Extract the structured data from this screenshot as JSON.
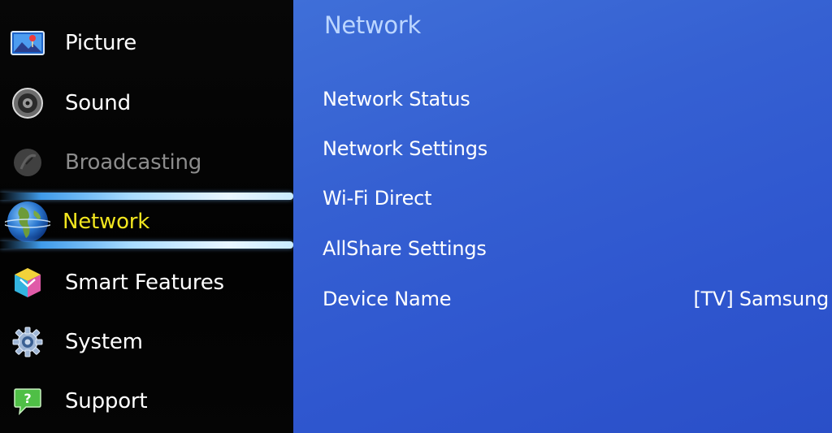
{
  "sidebar": {
    "items": [
      {
        "label": "Picture",
        "icon": "picture-icon",
        "state": "normal"
      },
      {
        "label": "Sound",
        "icon": "speaker-icon",
        "state": "normal"
      },
      {
        "label": "Broadcasting",
        "icon": "satellite-dish-icon",
        "state": "disabled"
      },
      {
        "label": "Network",
        "icon": "globe-icon",
        "state": "selected"
      },
      {
        "label": "Smart Features",
        "icon": "smart-cube-icon",
        "state": "normal"
      },
      {
        "label": "System",
        "icon": "gear-icon",
        "state": "normal"
      },
      {
        "label": "Support",
        "icon": "help-bubble-icon",
        "state": "normal"
      }
    ]
  },
  "main": {
    "title": "Network",
    "items": [
      {
        "label": "Network Status",
        "value": ""
      },
      {
        "label": "Network Settings",
        "value": ""
      },
      {
        "label": "Wi-Fi Direct",
        "value": ""
      },
      {
        "label": "AllShare Settings",
        "value": ""
      },
      {
        "label": "Device Name",
        "value": "[TV] Samsung"
      }
    ]
  },
  "colors": {
    "panel_blue": "#3560d2",
    "selected_text": "#f2e61f",
    "disabled_text": "#8c8c8c",
    "title_text": "#bcd6ff"
  }
}
